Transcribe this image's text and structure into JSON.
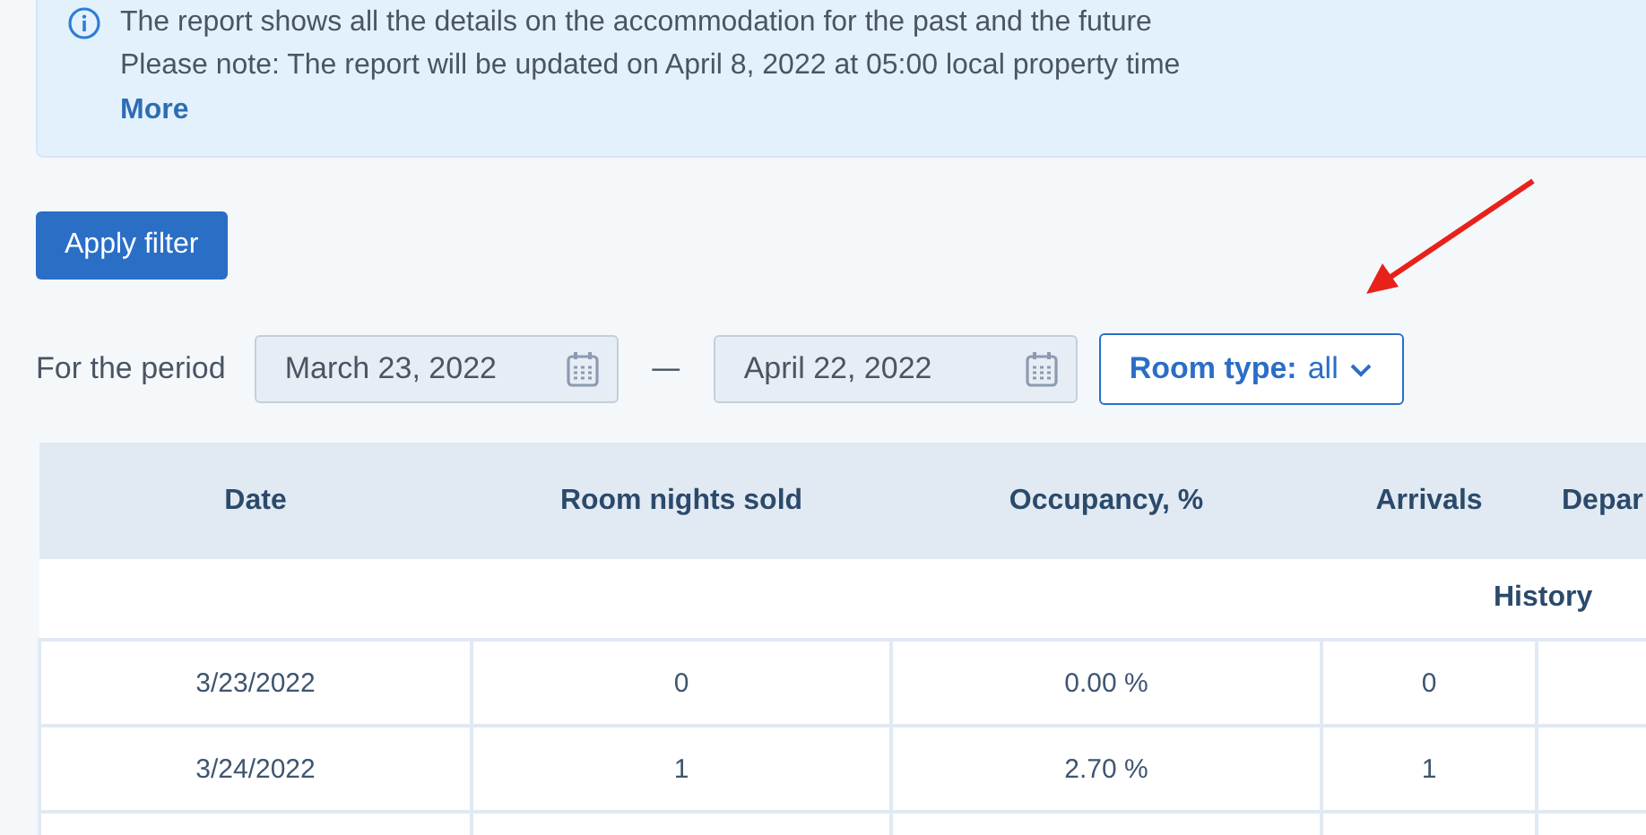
{
  "notice": {
    "lines": [
      "The report shows all the details on the accommodation for the past and the future",
      "Please note: The report will be updated on April 8, 2022 at 05:00 local property time"
    ],
    "link": "More"
  },
  "apply_button": "Apply filter",
  "period": {
    "label": "For the period",
    "from": "March 23, 2022",
    "separator": "—",
    "to": "April 22, 2022"
  },
  "room_type": {
    "label": "Room type:",
    "value": "all"
  },
  "table": {
    "columns": [
      "Date",
      "Room nights sold",
      "Occupancy, %",
      "Arrivals",
      "Depar"
    ],
    "section": "History",
    "rows": [
      [
        "3/23/2022",
        "0",
        "0.00 %",
        "0"
      ],
      [
        "3/24/2022",
        "1",
        "2.70 %",
        "1"
      ]
    ]
  }
}
